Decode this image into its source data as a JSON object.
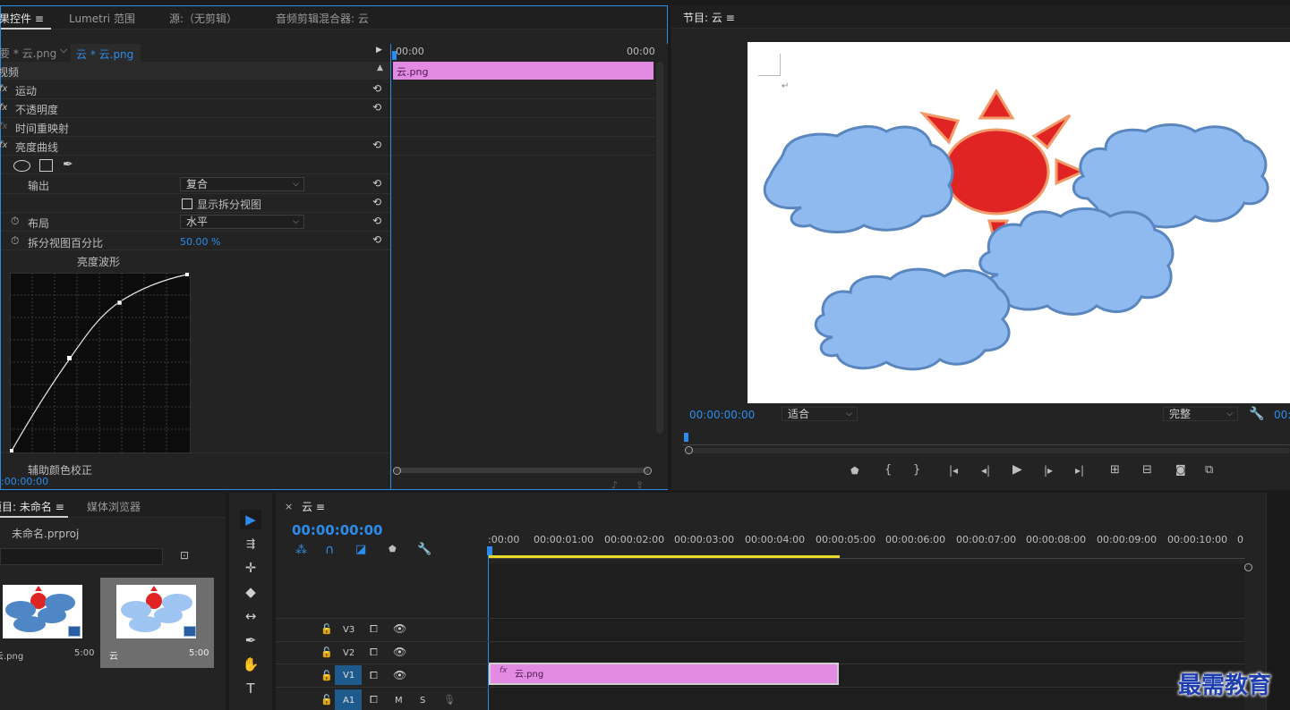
{
  "effect_controls": {
    "tabs": [
      "效果控件",
      "Lumetri 范围",
      "源:（无剪辑）",
      "音频剪辑混合器: 云"
    ],
    "menu_glyph": "≡",
    "source_clip": "主要 * 云.png",
    "seq_clip": "云 * 云.png",
    "section": "视频",
    "fx_items": [
      "运动",
      "不透明度",
      "时间重映射",
      "亮度曲线"
    ],
    "output_label": "输出",
    "output_value": "复合",
    "split_view_label": "显示拆分视图",
    "layout_label": "布局",
    "layout_value": "水平",
    "split_percent_label": "拆分视图百分比",
    "split_percent_value": "50.00 %",
    "waveform_label": "亮度波形",
    "aux_label": "辅助颜色校正",
    "timecode": "00:00:00:00",
    "mini_tl_start": "00:00",
    "mini_tl_end": "00:00",
    "mini_clip": "云.png"
  },
  "program_monitor": {
    "title": "节目: 云",
    "timecode": "00:00:00:00",
    "fit_value": "适合",
    "quality_value": "完整",
    "tc_right": "00:"
  },
  "project": {
    "tab_project": "项目: 未命名",
    "tab_browser": "媒体浏览器",
    "project_file": "未命名.prproj",
    "items": [
      {
        "name": "云.png",
        "duration": "5:00"
      },
      {
        "name": "云",
        "duration": "5:00"
      }
    ]
  },
  "timeline": {
    "close_glyph": "×",
    "title": "云",
    "timecode": "00:00:00:00",
    "ruler": [
      ":00:00",
      "00:00:01:00",
      "00:00:02:00",
      "00:00:03:00",
      "00:00:04:00",
      "00:00:05:00",
      "00:00:06:00",
      "00:00:07:00",
      "00:00:08:00",
      "00:00:09:00",
      "00:00:10:00",
      "0"
    ],
    "tracks": [
      "V3",
      "V2",
      "V1",
      "A1"
    ],
    "clip_label": "云.png",
    "clip_fx": "fx",
    "audio_m": "M",
    "audio_s": "S"
  },
  "watermark": "最需教育",
  "colors": {
    "accent_blue": "#2d8ceb",
    "clip_pink": "#e38ae3",
    "cloud_blue": "#8fbaf0",
    "sun_red": "#e02424"
  }
}
